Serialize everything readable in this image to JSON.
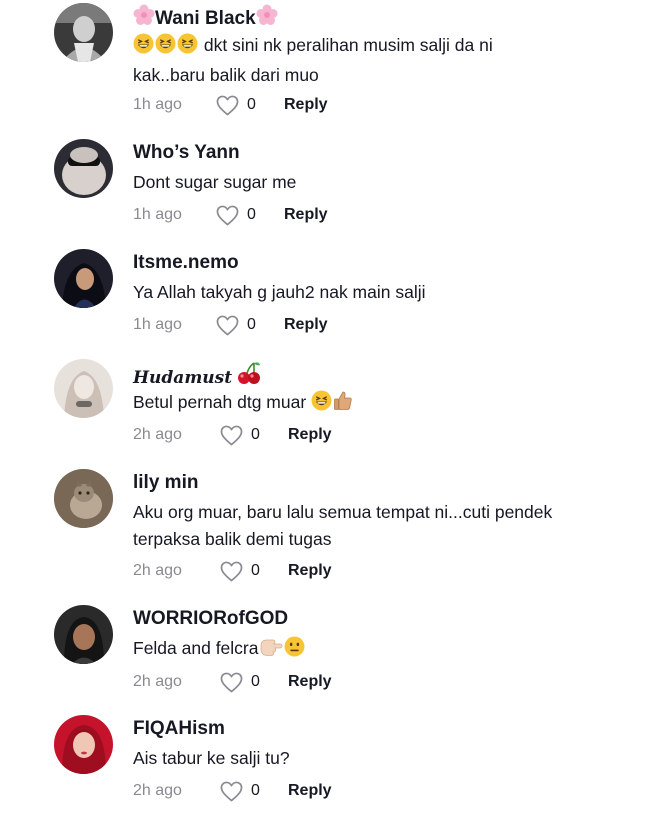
{
  "colors": {
    "text": "#161823",
    "muted": "#8a8b91"
  },
  "comments": [
    {
      "username": "Wani Black",
      "username_decoration_icon": "cherry-blossom-icon",
      "text": "dkt sini nk peralihan musim salji da ni kak..baru balik dari muo",
      "text_emoji_icons": [
        "grinning-squinting-face-icon",
        "grinning-squinting-face-icon",
        "grinning-squinting-face-icon"
      ],
      "time": "1h ago",
      "likes": "0",
      "reply_label": "Reply"
    },
    {
      "username": "Who’s Yann",
      "text": "Dont sugar sugar me",
      "time": "1h ago",
      "likes": "0",
      "reply_label": "Reply"
    },
    {
      "username": "Itsme.nemo",
      "text": "Ya Allah takyah g jauh2 nak main salji",
      "time": "1h ago",
      "likes": "0",
      "reply_label": "Reply"
    },
    {
      "username": "Hudamust",
      "username_decoration_icon": "cherries-icon",
      "text": "Betul pernah dtg muar",
      "text_emoji_icons": [
        "grinning-squinting-face-icon",
        "thumbs-up-icon"
      ],
      "time": "2h ago",
      "likes": "0",
      "reply_label": "Reply"
    },
    {
      "username": "lily min",
      "text": "Aku org muar, baru lalu semua tempat ni...cuti pendek terpaksa balik demi tugas",
      "time": "2h ago",
      "likes": "0",
      "reply_label": "Reply"
    },
    {
      "username": "WORRIORofGOD",
      "text": "Felda and felcra",
      "text_emoji_icons": [
        "pointing-hand-icon",
        "neutral-face-icon"
      ],
      "time": "2h ago",
      "likes": "0",
      "reply_label": "Reply"
    },
    {
      "username": "FIQAHism",
      "text": "Ais tabur ke salji tu?",
      "time": "2h ago",
      "likes": "0",
      "reply_label": "Reply"
    }
  ]
}
